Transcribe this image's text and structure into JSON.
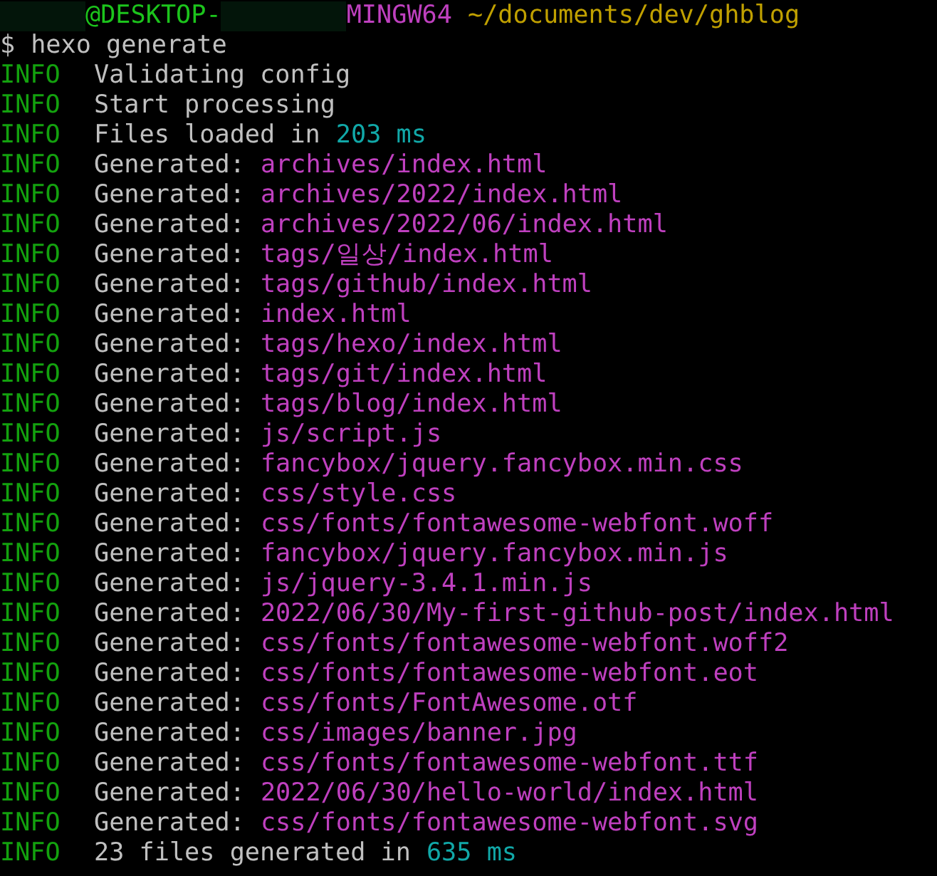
{
  "prompt": {
    "user": "@DESKTOP-",
    "system": "MINGW64",
    "path": "~/documents/dev/ghblog"
  },
  "command": {
    "symbol": "$",
    "text": "hexo generate"
  },
  "lines": [
    {
      "tag": "INFO",
      "parts": [
        {
          "kind": "text",
          "text": "Validating config"
        }
      ]
    },
    {
      "tag": "INFO",
      "parts": [
        {
          "kind": "text",
          "text": "Start processing"
        }
      ]
    },
    {
      "tag": "INFO",
      "parts": [
        {
          "kind": "text",
          "text": "Files loaded in"
        },
        {
          "kind": "number",
          "text": "203 ms"
        }
      ]
    },
    {
      "tag": "INFO",
      "parts": [
        {
          "kind": "text",
          "text": "Generated:"
        },
        {
          "kind": "path",
          "text": "archives/index.html"
        }
      ]
    },
    {
      "tag": "INFO",
      "parts": [
        {
          "kind": "text",
          "text": "Generated:"
        },
        {
          "kind": "path",
          "text": "archives/2022/index.html"
        }
      ]
    },
    {
      "tag": "INFO",
      "parts": [
        {
          "kind": "text",
          "text": "Generated:"
        },
        {
          "kind": "path",
          "text": "archives/2022/06/index.html"
        }
      ]
    },
    {
      "tag": "INFO",
      "parts": [
        {
          "kind": "text",
          "text": "Generated:"
        },
        {
          "kind": "path",
          "text": "tags/일상/index.html"
        }
      ]
    },
    {
      "tag": "INFO",
      "parts": [
        {
          "kind": "text",
          "text": "Generated:"
        },
        {
          "kind": "path",
          "text": "tags/github/index.html"
        }
      ]
    },
    {
      "tag": "INFO",
      "parts": [
        {
          "kind": "text",
          "text": "Generated:"
        },
        {
          "kind": "path",
          "text": "index.html"
        }
      ]
    },
    {
      "tag": "INFO",
      "parts": [
        {
          "kind": "text",
          "text": "Generated:"
        },
        {
          "kind": "path",
          "text": "tags/hexo/index.html"
        }
      ]
    },
    {
      "tag": "INFO",
      "parts": [
        {
          "kind": "text",
          "text": "Generated:"
        },
        {
          "kind": "path",
          "text": "tags/git/index.html"
        }
      ]
    },
    {
      "tag": "INFO",
      "parts": [
        {
          "kind": "text",
          "text": "Generated:"
        },
        {
          "kind": "path",
          "text": "tags/blog/index.html"
        }
      ]
    },
    {
      "tag": "INFO",
      "parts": [
        {
          "kind": "text",
          "text": "Generated:"
        },
        {
          "kind": "path",
          "text": "js/script.js"
        }
      ]
    },
    {
      "tag": "INFO",
      "parts": [
        {
          "kind": "text",
          "text": "Generated:"
        },
        {
          "kind": "path",
          "text": "fancybox/jquery.fancybox.min.css"
        }
      ]
    },
    {
      "tag": "INFO",
      "parts": [
        {
          "kind": "text",
          "text": "Generated:"
        },
        {
          "kind": "path",
          "text": "css/style.css"
        }
      ]
    },
    {
      "tag": "INFO",
      "parts": [
        {
          "kind": "text",
          "text": "Generated:"
        },
        {
          "kind": "path",
          "text": "css/fonts/fontawesome-webfont.woff"
        }
      ]
    },
    {
      "tag": "INFO",
      "parts": [
        {
          "kind": "text",
          "text": "Generated:"
        },
        {
          "kind": "path",
          "text": "fancybox/jquery.fancybox.min.js"
        }
      ]
    },
    {
      "tag": "INFO",
      "parts": [
        {
          "kind": "text",
          "text": "Generated:"
        },
        {
          "kind": "path",
          "text": "js/jquery-3.4.1.min.js"
        }
      ]
    },
    {
      "tag": "INFO",
      "parts": [
        {
          "kind": "text",
          "text": "Generated:"
        },
        {
          "kind": "path",
          "text": "2022/06/30/My-first-github-post/index.html"
        }
      ]
    },
    {
      "tag": "INFO",
      "parts": [
        {
          "kind": "text",
          "text": "Generated:"
        },
        {
          "kind": "path",
          "text": "css/fonts/fontawesome-webfont.woff2"
        }
      ]
    },
    {
      "tag": "INFO",
      "parts": [
        {
          "kind": "text",
          "text": "Generated:"
        },
        {
          "kind": "path",
          "text": "css/fonts/fontawesome-webfont.eot"
        }
      ]
    },
    {
      "tag": "INFO",
      "parts": [
        {
          "kind": "text",
          "text": "Generated:"
        },
        {
          "kind": "path",
          "text": "css/fonts/FontAwesome.otf"
        }
      ]
    },
    {
      "tag": "INFO",
      "parts": [
        {
          "kind": "text",
          "text": "Generated:"
        },
        {
          "kind": "path",
          "text": "css/images/banner.jpg"
        }
      ]
    },
    {
      "tag": "INFO",
      "parts": [
        {
          "kind": "text",
          "text": "Generated:"
        },
        {
          "kind": "path",
          "text": "css/fonts/fontawesome-webfont.ttf"
        }
      ]
    },
    {
      "tag": "INFO",
      "parts": [
        {
          "kind": "text",
          "text": "Generated:"
        },
        {
          "kind": "path",
          "text": "2022/06/30/hello-world/index.html"
        }
      ]
    },
    {
      "tag": "INFO",
      "parts": [
        {
          "kind": "text",
          "text": "Generated:"
        },
        {
          "kind": "path",
          "text": "css/fonts/fontawesome-webfont.svg"
        }
      ]
    },
    {
      "tag": "INFO",
      "parts": [
        {
          "kind": "text",
          "text": "23 files generated in"
        },
        {
          "kind": "number",
          "text": "635 ms"
        }
      ]
    }
  ]
}
